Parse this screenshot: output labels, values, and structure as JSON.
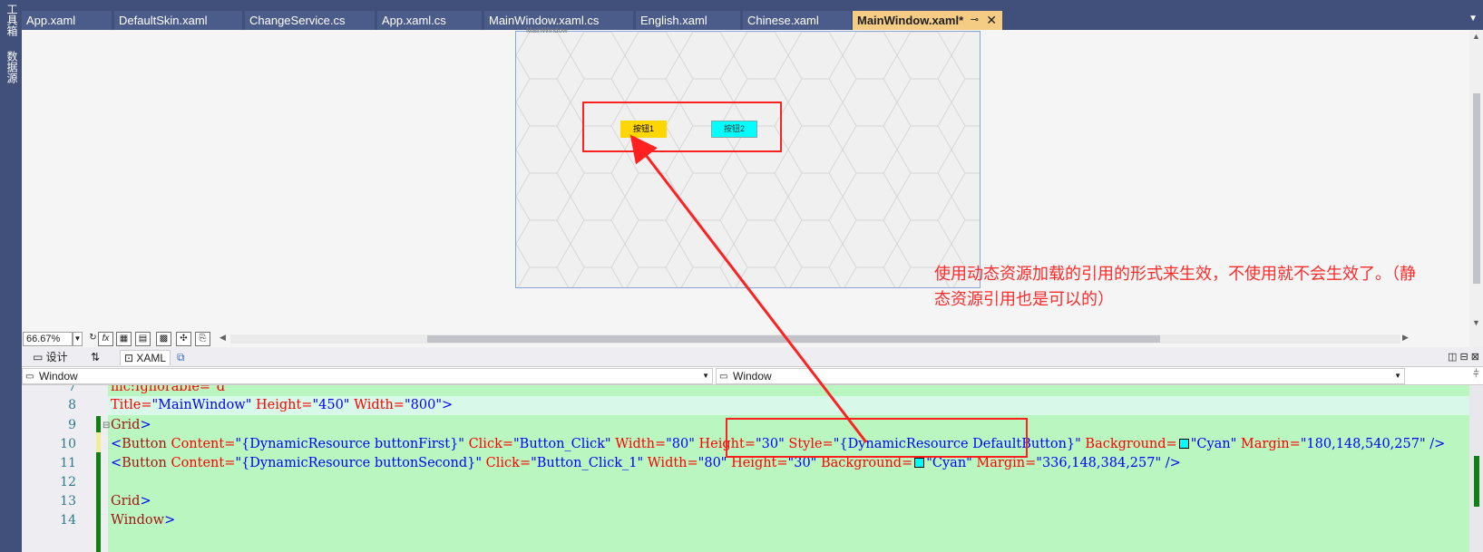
{
  "left_strip": {
    "items": [
      "工具箱",
      "数据源"
    ]
  },
  "tabs": [
    {
      "label": "App.xaml"
    },
    {
      "label": "DefaultSkin.xaml"
    },
    {
      "label": "ChangeService.cs"
    },
    {
      "label": "App.xaml.cs"
    },
    {
      "label": "MainWindow.xaml.cs"
    },
    {
      "label": "English.xaml"
    },
    {
      "label": "Chinese.xaml"
    },
    {
      "label": "MainWindow.xaml*",
      "active": true
    }
  ],
  "tab_icons": {
    "pin": "pin-icon",
    "close": "close-icon",
    "overflow": "chevron-down-icon"
  },
  "designer": {
    "window_title": "MainWindow",
    "button1_label": "按钮1",
    "button1_color": "#FFD700",
    "button2_label": "按钮2",
    "button2_color": "#00FFFF"
  },
  "annotation": {
    "text": "使用动态资源加载的引用的形式来生效，不使用就不会生效了。（静态资源引用也是可以的）",
    "color": "#FF2A2A"
  },
  "toolbar": {
    "zoom": "66.67%",
    "fx_label": "fx"
  },
  "switcher": {
    "design_label": "设计",
    "swap_label": "⇅",
    "xaml_label": "XAML"
  },
  "nav": {
    "left_dropdown": "Window",
    "right_dropdown": "Window"
  },
  "code_lines": [
    {
      "num": "7",
      "parts": [
        {
          "t": "mc:Ignorable=\"d\"",
          "c": "attr"
        }
      ]
    },
    {
      "num": "8",
      "parts": [
        {
          "t": "Title=",
          "c": "attr"
        },
        {
          "t": "\"MainWindow\"",
          "c": "val"
        },
        {
          "t": " Height=",
          "c": "attr"
        },
        {
          "t": "\"450\"",
          "c": "val"
        },
        {
          "t": " Width=",
          "c": "attr"
        },
        {
          "t": "\"800\"",
          "c": "val"
        },
        {
          "t": ">",
          "c": "val"
        }
      ]
    },
    {
      "num": "9",
      "parts": [
        {
          "t": "Grid",
          "c": "tag"
        },
        {
          "t": ">",
          "c": "val"
        }
      ]
    },
    {
      "num": "10",
      "parts": [
        {
          "t": "<",
          "c": "val"
        },
        {
          "t": "Button",
          "c": "tag"
        },
        {
          "t": " Content=",
          "c": "attr"
        },
        {
          "t": "\"{DynamicResource buttonFirst}\"",
          "c": "val"
        },
        {
          "t": " Click=",
          "c": "attr"
        },
        {
          "t": "\"Button_Click\"",
          "c": "val"
        },
        {
          "t": " Width=",
          "c": "attr"
        },
        {
          "t": "\"80\"",
          "c": "val"
        },
        {
          "t": " Height=",
          "c": "attr"
        },
        {
          "t": "\"30\"",
          "c": "val"
        },
        {
          "t": " Style=",
          "c": "attr"
        },
        {
          "t": "\"{DynamicResource DefaultButton}\"",
          "c": "val"
        },
        {
          "t": " Background=",
          "c": "attr"
        },
        {
          "t": "SWATCH",
          "c": "swatch"
        },
        {
          "t": "\"Cyan\"",
          "c": "val"
        },
        {
          "t": " Margin=",
          "c": "attr"
        },
        {
          "t": "\"180,148,540,257\"",
          "c": "val"
        },
        {
          "t": " />",
          "c": "val"
        }
      ]
    },
    {
      "num": "11",
      "parts": [
        {
          "t": "<",
          "c": "val"
        },
        {
          "t": "Button",
          "c": "tag"
        },
        {
          "t": " Content=",
          "c": "attr"
        },
        {
          "t": "\"{DynamicResource buttonSecond}\"",
          "c": "val"
        },
        {
          "t": " Click=",
          "c": "attr"
        },
        {
          "t": "\"Button_Click_1\"",
          "c": "val"
        },
        {
          "t": " Width=",
          "c": "attr"
        },
        {
          "t": "\"80\"",
          "c": "val"
        },
        {
          "t": " Height=",
          "c": "attr"
        },
        {
          "t": "\"30\"",
          "c": "val"
        },
        {
          "t": " Background=",
          "c": "attr"
        },
        {
          "t": "SWATCH",
          "c": "swatch"
        },
        {
          "t": "\"Cyan\"",
          "c": "val"
        },
        {
          "t": " Margin=",
          "c": "attr"
        },
        {
          "t": "\"336,148,384,257\"",
          "c": "val"
        },
        {
          "t": " />",
          "c": "val"
        }
      ]
    },
    {
      "num": "12",
      "parts": []
    },
    {
      "num": "13",
      "parts": [
        {
          "t": "Grid",
          "c": "tag"
        },
        {
          "t": ">",
          "c": "val"
        }
      ]
    },
    {
      "num": "14",
      "parts": [
        {
          "t": "Window",
          "c": "tag"
        },
        {
          "t": ">",
          "c": "val"
        }
      ]
    }
  ]
}
